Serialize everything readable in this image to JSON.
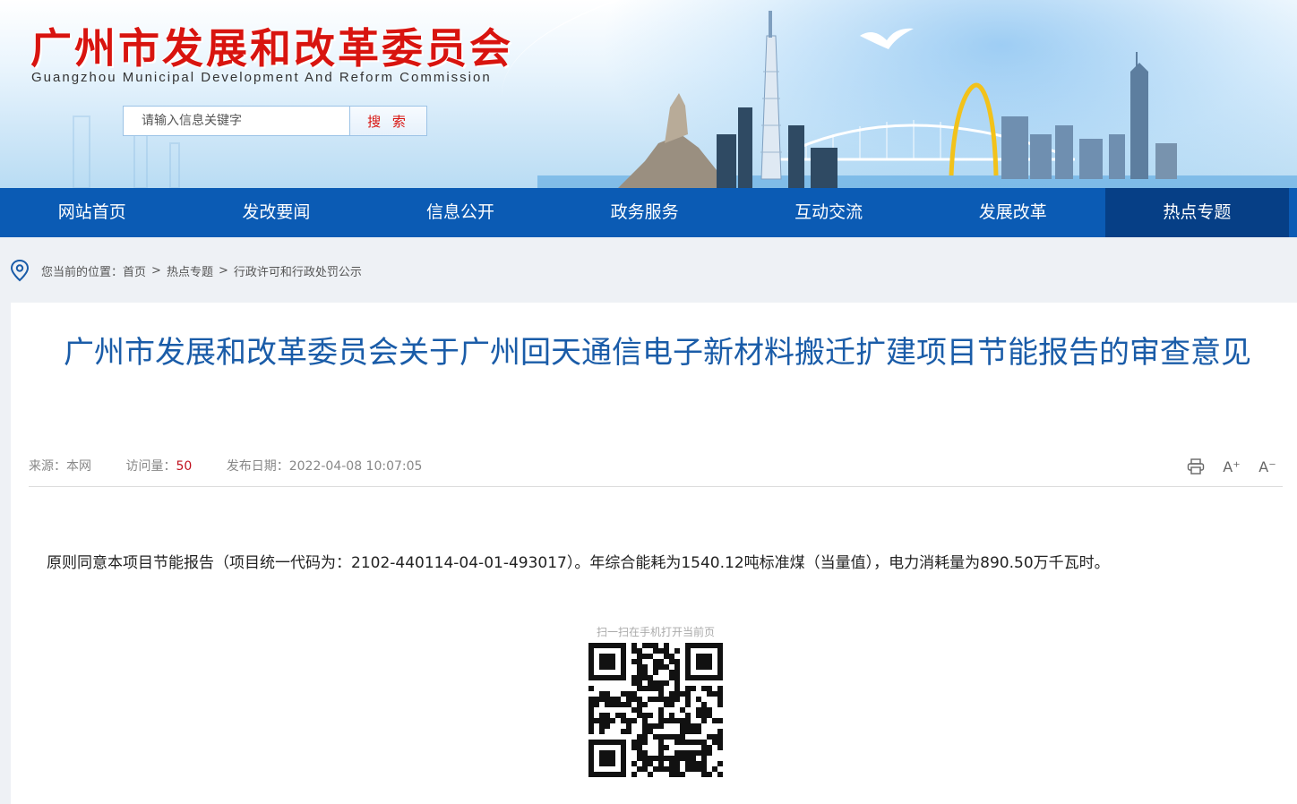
{
  "header": {
    "title": "广州市发展和改革委员会",
    "subtitle": "Guangzhou Municipal Development And Reform Commission",
    "search_placeholder": "请输入信息关键字",
    "search_button": "搜 索"
  },
  "nav": {
    "items": [
      "网站首页",
      "发改要闻",
      "信息公开",
      "政务服务",
      "互动交流",
      "发展改革",
      "热点专题"
    ],
    "active": "热点专题"
  },
  "breadcrumb": {
    "prefix": "您当前的位置：",
    "items": [
      "首页",
      "热点专题",
      "行政许可和行政处罚公示"
    ],
    "separator": ">"
  },
  "article": {
    "title": "广州市发展和改革委员会关于广州回天通信电子新材料搬迁扩建项目节能报告的审查意见",
    "source_label": "来源：本网",
    "views_label": "访问量：",
    "views_count": "50",
    "date_label": "发布日期：2022-04-08 10:07:05",
    "body": "原则同意本项目节能报告（项目统一代码为：2102-440114-04-01-493017）。年综合能耗为1540.12吨标准煤（当量值），电力消耗量为890.50万千瓦时。",
    "tools": {
      "font_up": "A⁺",
      "font_down": "A⁻"
    },
    "qr_caption": "扫一扫在手机打开当前页"
  },
  "colors": {
    "brand_red": "#d8140f",
    "nav_blue": "#0b5bb4",
    "nav_active": "#063f86",
    "title_blue": "#1a5ca8"
  }
}
